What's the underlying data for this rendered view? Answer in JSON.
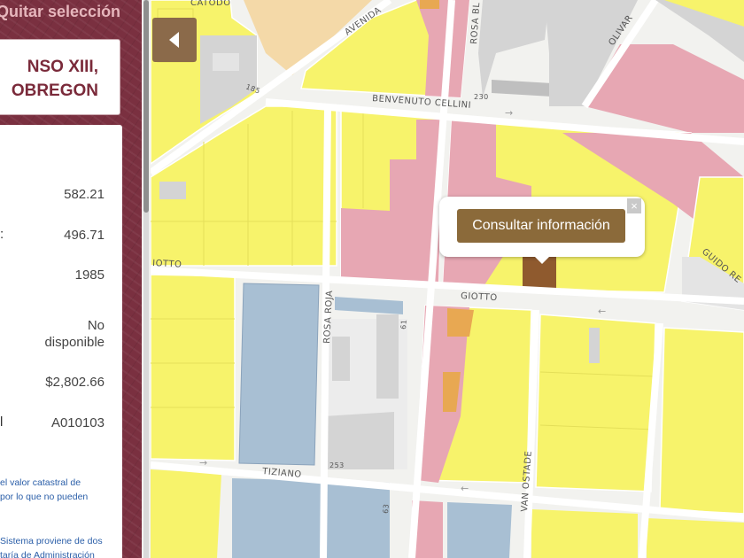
{
  "panel": {
    "clear_selection": "Quitar selección",
    "title_line1": "NSO XIII,",
    "title_line2": "OBREGON",
    "rows": [
      {
        "label": "",
        "value": "582.21"
      },
      {
        "label": ":",
        "value": "496.71"
      },
      {
        "label": "",
        "value": "1985"
      },
      {
        "label": "",
        "value_line1": "No",
        "value_line2": "disponible"
      },
      {
        "label": "",
        "value": "$2,802.66"
      },
      {
        "label": "l",
        "value": "A010103"
      }
    ],
    "note1_line1": "el valor catastral de",
    "note1_line2": "por lo que no pueden",
    "note2_line1": "Sistema proviene de dos",
    "note2_line2": "taría de Administración"
  },
  "map": {
    "popup_button": "Consultar información",
    "close_symbol": "×",
    "streets": {
      "avenida": "AVENIDA",
      "rosa_bl": "ROSA BL",
      "olivar": "OLIVAR",
      "benvenuto": "BENVENUTO CELLINI",
      "giotto_left": "IOTTO",
      "giotto": "GIOTTO",
      "rosa_roja": "ROSA ROJA",
      "tiziano": "TIZIANO",
      "van_ostade": "VAN OSTADE",
      "guido": "GUIDO RE",
      "catodo": "CATODO"
    },
    "numbers": {
      "n185": "185",
      "n230": "230",
      "n61": "61",
      "n63": "63",
      "n253": "253"
    },
    "colors": {
      "yellow": "#f7f36b",
      "pink": "#e7a7b3",
      "blue": "#a8bfd3",
      "orange": "#e8a852",
      "selected": "#8f5a2e",
      "gray": "#d4d4d4",
      "peach": "#f4d9a8"
    }
  }
}
